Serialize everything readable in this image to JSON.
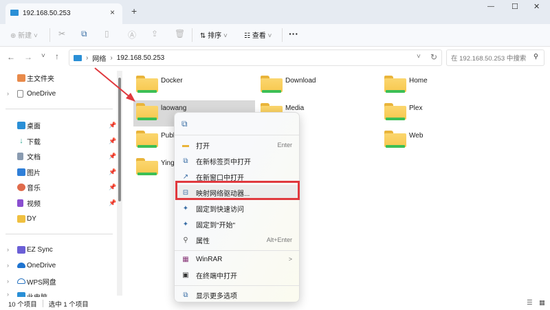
{
  "window": {
    "tab_title": "192.168.50.253",
    "close_tab": "×",
    "new_tab": "+",
    "min": "—",
    "max": "☐",
    "close": "✕"
  },
  "toolbar": {
    "new_label": "新建",
    "sort_label": "排序",
    "view_label": "查看",
    "more": "···"
  },
  "address": {
    "segments": [
      "网络",
      "192.168.50.253"
    ],
    "search_placeholder": "在 192.168.50.253 中搜索"
  },
  "sidebar": {
    "top": [
      {
        "label": "主文件夹"
      },
      {
        "label": "OneDrive"
      }
    ],
    "pinned": [
      {
        "label": "桌面",
        "color": "#2a8fd6"
      },
      {
        "label": "下载",
        "color": "#2aa58f"
      },
      {
        "label": "文档",
        "color": "#8a9bb0"
      },
      {
        "label": "图片",
        "color": "#2f7fd8"
      },
      {
        "label": "音乐",
        "color": "#e06b4c"
      },
      {
        "label": "视频",
        "color": "#8a4fd0"
      },
      {
        "label": "DY",
        "color": "#f0c040"
      }
    ],
    "bottom": [
      {
        "label": "EZ Sync",
        "color": "#6b5fd6"
      },
      {
        "label": "OneDrive",
        "color": "#1f74d0"
      },
      {
        "label": "WPS网盘",
        "color": "#ffffff"
      },
      {
        "label": "此电脑",
        "color": "#2a8fd6"
      }
    ]
  },
  "files": [
    {
      "name": "Docker"
    },
    {
      "name": "Download"
    },
    {
      "name": "Home"
    },
    {
      "name": "laowang"
    },
    {
      "name": "Media"
    },
    {
      "name": "Plex"
    },
    {
      "name": "Publ"
    },
    {
      "name": "o"
    },
    {
      "name": "Web"
    },
    {
      "name": "Ying"
    }
  ],
  "context_menu": {
    "items": [
      {
        "label": "打开",
        "shortcut": "Enter"
      },
      {
        "label": "在新标签页中打开"
      },
      {
        "label": "在新窗口中打开"
      },
      {
        "label": "映射网络驱动器..."
      },
      {
        "label": "固定到快速访问"
      },
      {
        "label": "固定到\"开始\""
      },
      {
        "label": "属性",
        "shortcut": "Alt+Enter"
      },
      {
        "label": "WinRAR",
        "submenu": ">"
      },
      {
        "label": "在终端中打开"
      },
      {
        "label": "显示更多选项"
      }
    ]
  },
  "status": {
    "count": "10 个项目",
    "selected": "选中 1 个项目"
  },
  "colors": {
    "highlight": "#e0393e",
    "arrow": "#e0393e"
  }
}
